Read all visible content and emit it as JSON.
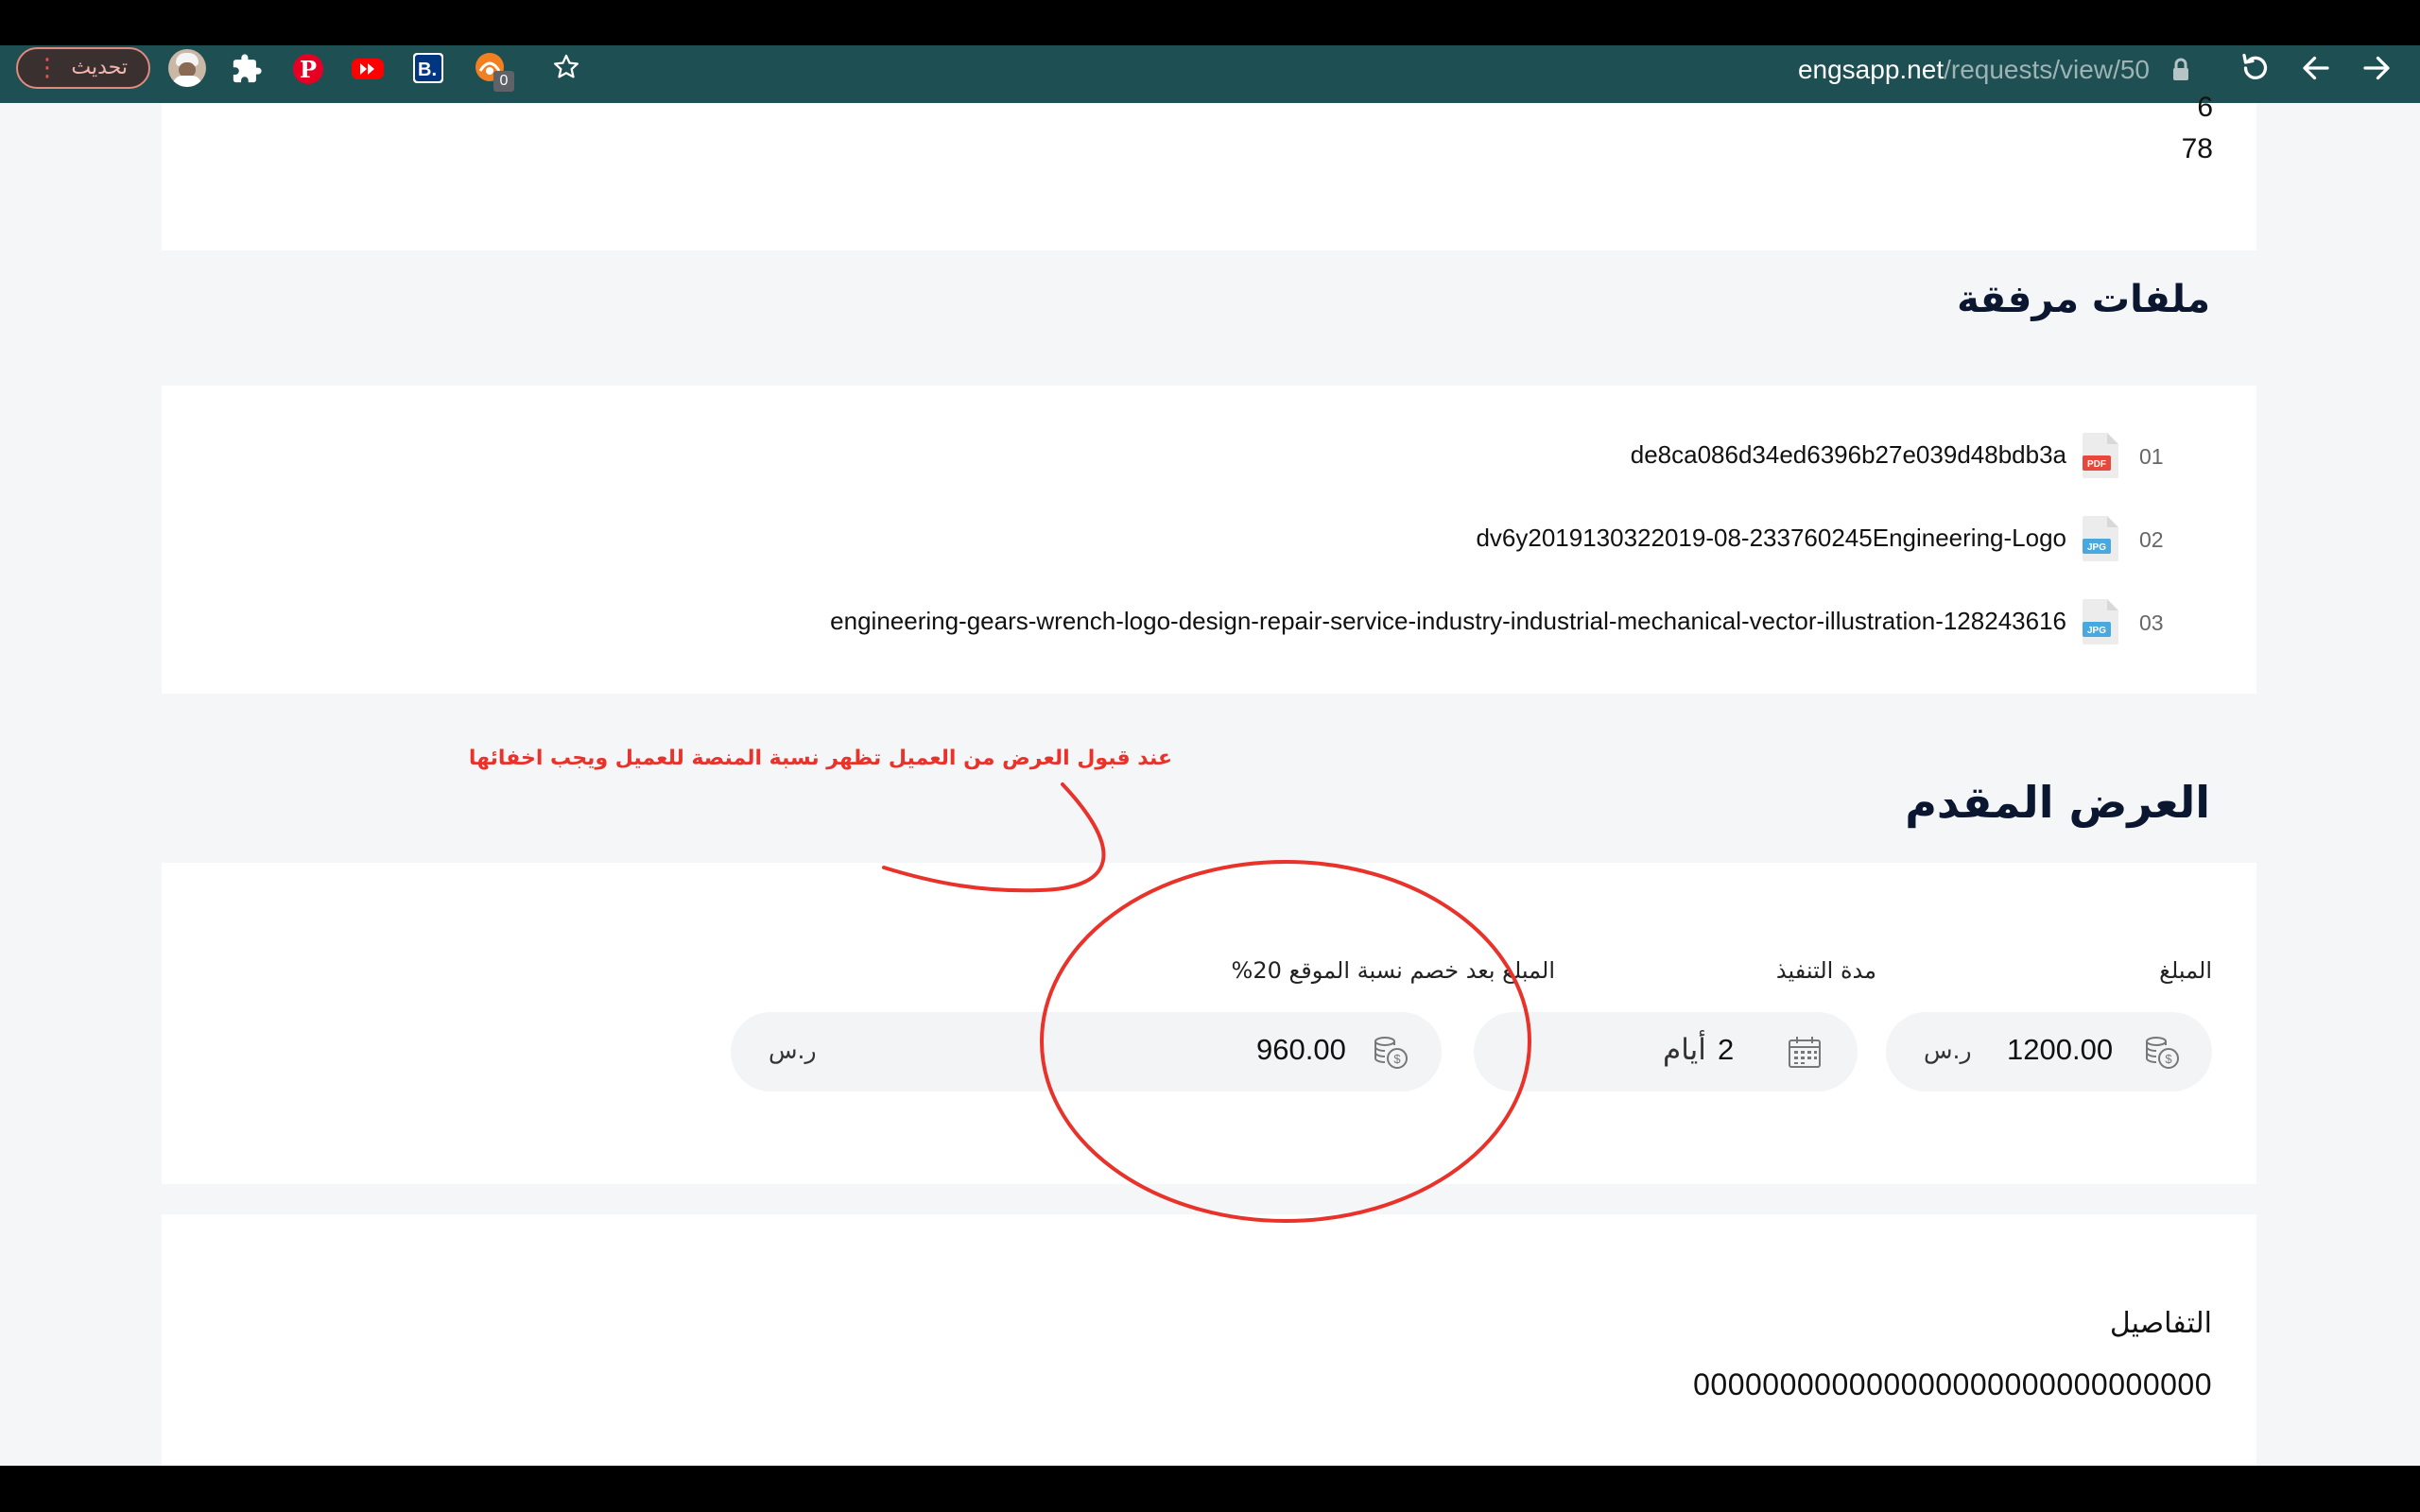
{
  "browser": {
    "url_host": "engsapp.net",
    "url_path": "/requests/view/50",
    "update_label": "تحديث",
    "extension_badge": "0"
  },
  "top_partial": {
    "line1": "6",
    "line2": "78"
  },
  "attachments": {
    "heading": "ملفات مرفقة",
    "files": [
      {
        "num": "01",
        "name": "de8ca086d34ed6396b27e039d48bdb3a",
        "type": "PDF",
        "color": "#e8473b"
      },
      {
        "num": "02",
        "name": "dv6y2019130322019-08-233760245Engineering-Logo",
        "type": "JPG",
        "color": "#4aa8e0"
      },
      {
        "num": "03",
        "name": "engineering-gears-wrench-logo-design-repair-service-industry-industrial-mechanical-vector-illustration-128243616",
        "type": "JPG",
        "color": "#4aa8e0"
      }
    ]
  },
  "annotation": {
    "note": "عند قبول العرض من العميل تظهر نسبة المنصة للعميل ويجب اخفائها",
    "color": "#e8322a"
  },
  "offer": {
    "heading": "العرض المقدم",
    "amount_label": "المبلغ",
    "amount_value": "1200.00",
    "amount_unit": "ر.س",
    "duration_label": "مدة التنفيذ",
    "duration_value": "2",
    "duration_unit": "أيام",
    "net_label": "المبلغ بعد خصم نسبة الموقع 20%",
    "net_value": "960.00",
    "net_unit": "ر.س"
  },
  "details": {
    "heading": "التفاصيل",
    "text": "000000000000000000000000000000"
  }
}
